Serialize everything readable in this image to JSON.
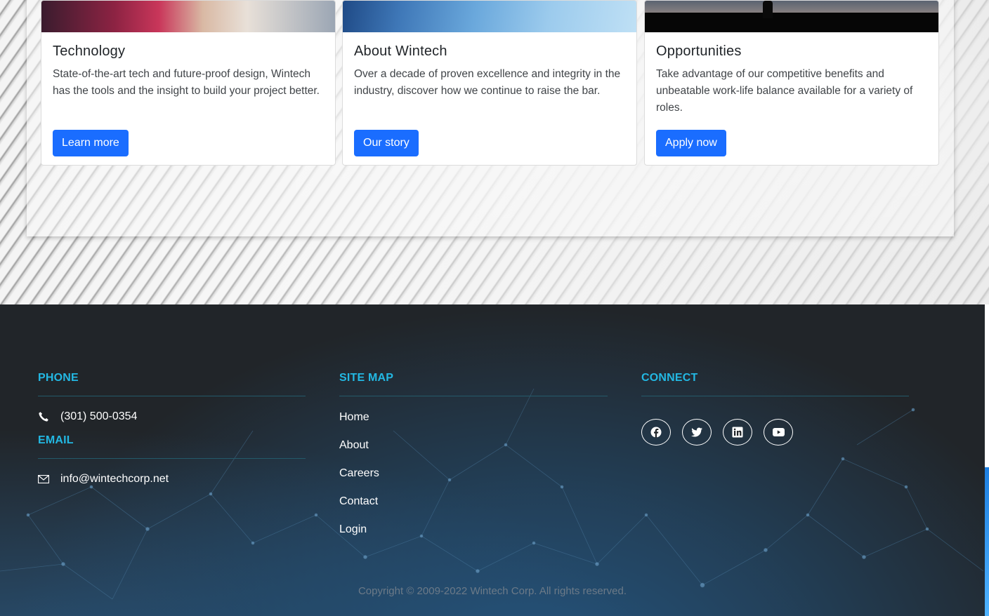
{
  "cards": [
    {
      "title": "Technology",
      "text": "State-of-the-art tech and future-proof design, Wintech has the tools and the insight to build your project better.",
      "button": "Learn more"
    },
    {
      "title": "About Wintech",
      "text": "Over a decade of proven excellence and integrity in the industry, discover how we continue to raise the bar.",
      "button": "Our story"
    },
    {
      "title": "Opportunities",
      "text": "Take advantage of our competitive benefits and unbeatable work-life balance available for a variety of roles.",
      "button": "Apply now"
    }
  ],
  "footer": {
    "phone": {
      "heading": "PHONE",
      "value": "(301) 500-0354",
      "icon": "phone-icon"
    },
    "email": {
      "heading": "EMAIL",
      "value": "info@wintechcorp.net",
      "icon": "envelope-icon"
    },
    "sitemap": {
      "heading": "SITE MAP",
      "links": [
        "Home",
        "About",
        "Careers",
        "Contact",
        "Login"
      ]
    },
    "connect": {
      "heading": "CONNECT",
      "socials": [
        "facebook-icon",
        "twitter-icon",
        "linkedin-icon",
        "youtube-icon"
      ]
    },
    "copyright": "Copyright © 2009-2022 Wintech Corp. All rights reserved."
  },
  "colors": {
    "accent": "#23b8e3",
    "button": "#1a6dff",
    "footer_bg": "#212529"
  }
}
